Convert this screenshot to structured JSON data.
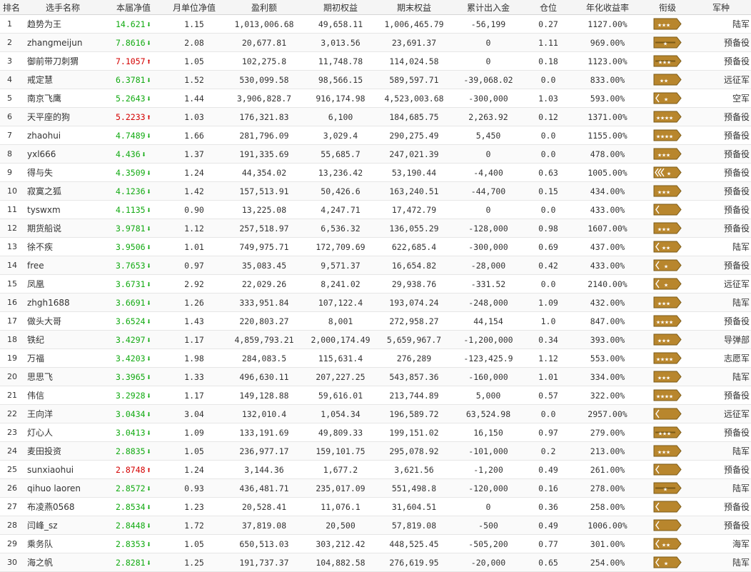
{
  "colors": {
    "up": "#d40000",
    "down": "#11aa11",
    "badge_fill": "#b8862d",
    "badge_dark": "#7a5a17",
    "badge_mark": "#ffffff"
  },
  "headers": [
    "排名",
    "选手名称",
    "本届净值",
    "月单位净值",
    "盈利额",
    "期初权益",
    "期末权益",
    "累计出入金",
    "仓位",
    "年化收益率",
    "衔级",
    "军种"
  ],
  "rows": [
    {
      "rank": "1",
      "name": "趋势为王",
      "nav": "14.621",
      "trend": "down",
      "arrow": "⬇",
      "unit_nav": "1.15",
      "profit": "1,013,006.68",
      "initial": "49,658.11",
      "final": "1,006,465.79",
      "flow": "-56,199",
      "position": "0.27",
      "annual": "1127.00%",
      "badge_icon": "stars-3",
      "branch": "陆军"
    },
    {
      "rank": "2",
      "name": "zhangmeijun",
      "nav": "7.8616",
      "trend": "down",
      "arrow": "⬇",
      "unit_nav": "2.08",
      "profit": "20,677.81",
      "initial": "3,013.56",
      "final": "23,691.37",
      "flow": "0",
      "position": "1.11",
      "annual": "969.00%",
      "badge_icon": "bar-star-1",
      "branch": "预备役"
    },
    {
      "rank": "3",
      "name": "御前带刀刺猬",
      "nav": "7.1057",
      "trend": "up",
      "arrow": "⬆",
      "unit_nav": "1.05",
      "profit": "102,275.8",
      "initial": "11,748.78",
      "final": "114,024.58",
      "flow": "0",
      "position": "0.18",
      "annual": "1123.00%",
      "badge_icon": "bar-stars-3",
      "branch": "预备役"
    },
    {
      "rank": "4",
      "name": "戒定慧",
      "nav": "6.3781",
      "trend": "down",
      "arrow": "⬇",
      "unit_nav": "1.52",
      "profit": "530,099.58",
      "initial": "98,566.15",
      "final": "589,597.71",
      "flow": "-39,068.02",
      "position": "0.0",
      "annual": "833.00%",
      "badge_icon": "stars-2",
      "branch": "远征军"
    },
    {
      "rank": "5",
      "name": "南京飞鹰",
      "nav": "5.2643",
      "trend": "down",
      "arrow": "⬇",
      "unit_nav": "1.44",
      "profit": "3,906,828.7",
      "initial": "916,174.98",
      "final": "4,523,003.68",
      "flow": "-300,000",
      "position": "1.03",
      "annual": "593.00%",
      "badge_icon": "chevron-star",
      "branch": "空军"
    },
    {
      "rank": "6",
      "name": "天平座的狗",
      "nav": "5.2233",
      "trend": "up",
      "arrow": "⬆",
      "unit_nav": "1.03",
      "profit": "176,321.83",
      "initial": "6,100",
      "final": "184,685.75",
      "flow": "2,263.92",
      "position": "0.12",
      "annual": "1371.00%",
      "badge_icon": "stars-4",
      "branch": "预备役"
    },
    {
      "rank": "7",
      "name": "zhaohui",
      "nav": "4.7489",
      "trend": "down",
      "arrow": "⬇",
      "unit_nav": "1.66",
      "profit": "281,796.09",
      "initial": "3,029.4",
      "final": "290,275.49",
      "flow": "5,450",
      "position": "0.0",
      "annual": "1155.00%",
      "badge_icon": "stars-4",
      "branch": "预备役"
    },
    {
      "rank": "8",
      "name": "yxl666",
      "nav": "4.436",
      "trend": "down",
      "arrow": "⬇",
      "unit_nav": "1.37",
      "profit": "191,335.69",
      "initial": "55,685.7",
      "final": "247,021.39",
      "flow": "0",
      "position": "0.0",
      "annual": "478.00%",
      "badge_icon": "stars-3",
      "branch": "预备役"
    },
    {
      "rank": "9",
      "name": "得与失",
      "nav": "4.3509",
      "trend": "down",
      "arrow": "⬇",
      "unit_nav": "1.24",
      "profit": "44,354.02",
      "initial": "13,236.42",
      "final": "53,190.44",
      "flow": "-4,400",
      "position": "0.63",
      "annual": "1005.00%",
      "badge_icon": "chevron3-star",
      "branch": "预备役"
    },
    {
      "rank": "10",
      "name": "寂寞之狐",
      "nav": "4.1236",
      "trend": "down",
      "arrow": "⬇",
      "unit_nav": "1.42",
      "profit": "157,513.91",
      "initial": "50,426.6",
      "final": "163,240.51",
      "flow": "-44,700",
      "position": "0.15",
      "annual": "434.00%",
      "badge_icon": "stars-3",
      "branch": "预备役"
    },
    {
      "rank": "11",
      "name": "tyswxm",
      "nav": "4.1135",
      "trend": "down",
      "arrow": "⬇",
      "unit_nav": "0.90",
      "profit": "13,225.08",
      "initial": "4,247.71",
      "final": "17,472.79",
      "flow": "0",
      "position": "0.0",
      "annual": "433.00%",
      "badge_icon": "chevron-1",
      "branch": "预备役"
    },
    {
      "rank": "12",
      "name": "期货船说",
      "nav": "3.9781",
      "trend": "down",
      "arrow": "⬇",
      "unit_nav": "1.12",
      "profit": "257,518.97",
      "initial": "6,536.32",
      "final": "136,055.29",
      "flow": "-128,000",
      "position": "0.98",
      "annual": "1607.00%",
      "badge_icon": "stars-3",
      "branch": "预备役"
    },
    {
      "rank": "13",
      "name": "徐不疾",
      "nav": "3.9506",
      "trend": "down",
      "arrow": "⬇",
      "unit_nav": "1.01",
      "profit": "749,975.71",
      "initial": "172,709.69",
      "final": "622,685.4",
      "flow": "-300,000",
      "position": "0.69",
      "annual": "437.00%",
      "badge_icon": "chevron-stars-2",
      "branch": "陆军"
    },
    {
      "rank": "14",
      "name": "free",
      "nav": "3.7653",
      "trend": "down",
      "arrow": "⬇",
      "unit_nav": "0.97",
      "profit": "35,083.45",
      "initial": "9,571.37",
      "final": "16,654.82",
      "flow": "-28,000",
      "position": "0.42",
      "annual": "433.00%",
      "badge_icon": "chevron-star",
      "branch": "预备役"
    },
    {
      "rank": "15",
      "name": "凤凰",
      "nav": "3.6731",
      "trend": "down",
      "arrow": "⬇",
      "unit_nav": "2.92",
      "profit": "22,029.26",
      "initial": "8,241.02",
      "final": "29,938.76",
      "flow": "-331.52",
      "position": "0.0",
      "annual": "2140.00%",
      "badge_icon": "chevron-star",
      "branch": "远征军"
    },
    {
      "rank": "16",
      "name": "zhgh1688",
      "nav": "3.6691",
      "trend": "down",
      "arrow": "⬇",
      "unit_nav": "1.26",
      "profit": "333,951.84",
      "initial": "107,122.4",
      "final": "193,074.24",
      "flow": "-248,000",
      "position": "1.09",
      "annual": "432.00%",
      "badge_icon": "stars-3",
      "branch": "陆军"
    },
    {
      "rank": "17",
      "name": "做头大哥",
      "nav": "3.6524",
      "trend": "down",
      "arrow": "⬇",
      "unit_nav": "1.43",
      "profit": "220,803.27",
      "initial": "8,001",
      "final": "272,958.27",
      "flow": "44,154",
      "position": "1.0",
      "annual": "847.00%",
      "badge_icon": "stars-4",
      "branch": "预备役"
    },
    {
      "rank": "18",
      "name": "铁纪",
      "nav": "3.4297",
      "trend": "down",
      "arrow": "⬇",
      "unit_nav": "1.17",
      "profit": "4,859,793.21",
      "initial": "2,000,174.49",
      "final": "5,659,967.7",
      "flow": "-1,200,000",
      "position": "0.34",
      "annual": "393.00%",
      "badge_icon": "stars-3",
      "branch": "导弹部"
    },
    {
      "rank": "19",
      "name": "万福",
      "nav": "3.4203",
      "trend": "down",
      "arrow": "⬇",
      "unit_nav": "1.98",
      "profit": "284,083.5",
      "initial": "115,631.4",
      "final": "276,289",
      "flow": "-123,425.9",
      "position": "1.12",
      "annual": "553.00%",
      "badge_icon": "stars-4",
      "branch": "志愿军"
    },
    {
      "rank": "20",
      "name": "思思飞",
      "nav": "3.3965",
      "trend": "down",
      "arrow": "⬇",
      "unit_nav": "1.33",
      "profit": "496,630.11",
      "initial": "207,227.25",
      "final": "543,857.36",
      "flow": "-160,000",
      "position": "1.01",
      "annual": "334.00%",
      "badge_icon": "stars-3",
      "branch": "陆军"
    },
    {
      "rank": "21",
      "name": "伟信",
      "nav": "3.2928",
      "trend": "down",
      "arrow": "⬇",
      "unit_nav": "1.17",
      "profit": "149,128.88",
      "initial": "59,616.01",
      "final": "213,744.89",
      "flow": "5,000",
      "position": "0.57",
      "annual": "322.00%",
      "badge_icon": "stars-4",
      "branch": "预备役"
    },
    {
      "rank": "22",
      "name": "王向洋",
      "nav": "3.0434",
      "trend": "down",
      "arrow": "⬇",
      "unit_nav": "3.04",
      "profit": "132,010.4",
      "initial": "1,054.34",
      "final": "196,589.72",
      "flow": "63,524.98",
      "position": "0.0",
      "annual": "2957.00%",
      "badge_icon": "chevron-1",
      "branch": "远征军"
    },
    {
      "rank": "23",
      "name": "灯心人",
      "nav": "3.0413",
      "trend": "down",
      "arrow": "⬇",
      "unit_nav": "1.09",
      "profit": "133,191.69",
      "initial": "49,809.33",
      "final": "199,151.02",
      "flow": "16,150",
      "position": "0.97",
      "annual": "279.00%",
      "badge_icon": "bar-stars-3",
      "branch": "预备役"
    },
    {
      "rank": "24",
      "name": "麦田投资",
      "nav": "2.8835",
      "trend": "down",
      "arrow": "⬇",
      "unit_nav": "1.05",
      "profit": "236,977.17",
      "initial": "159,101.75",
      "final": "295,078.92",
      "flow": "-101,000",
      "position": "0.2",
      "annual": "213.00%",
      "badge_icon": "stars-3",
      "branch": "陆军"
    },
    {
      "rank": "25",
      "name": "sunxiaohui",
      "nav": "2.8748",
      "trend": "up",
      "arrow": "⬆",
      "unit_nav": "1.24",
      "profit": "3,144.36",
      "initial": "1,677.2",
      "final": "3,621.56",
      "flow": "-1,200",
      "position": "0.49",
      "annual": "261.00%",
      "badge_icon": "chevron-1",
      "branch": "预备役"
    },
    {
      "rank": "26",
      "name": "qihuo laoren",
      "nav": "2.8572",
      "trend": "down",
      "arrow": "⬇",
      "unit_nav": "0.93",
      "profit": "436,481.71",
      "initial": "235,017.09",
      "final": "551,498.8",
      "flow": "-120,000",
      "position": "0.16",
      "annual": "278.00%",
      "badge_icon": "bar-star-1",
      "branch": "陆军"
    },
    {
      "rank": "27",
      "name": "布凌燕0568",
      "nav": "2.8534",
      "trend": "down",
      "arrow": "⬇",
      "unit_nav": "1.23",
      "profit": "20,528.41",
      "initial": "11,076.1",
      "final": "31,604.51",
      "flow": "0",
      "position": "0.36",
      "annual": "258.00%",
      "badge_icon": "chevron-1",
      "branch": "预备役"
    },
    {
      "rank": "28",
      "name": "闫峰_sz",
      "nav": "2.8448",
      "trend": "down",
      "arrow": "⬇",
      "unit_nav": "1.72",
      "profit": "37,819.08",
      "initial": "20,500",
      "final": "57,819.08",
      "flow": "-500",
      "position": "0.49",
      "annual": "1006.00%",
      "badge_icon": "chevron-1",
      "branch": "预备役"
    },
    {
      "rank": "29",
      "name": "乘务队",
      "nav": "2.8353",
      "trend": "down",
      "arrow": "⬇",
      "unit_nav": "1.05",
      "profit": "650,513.03",
      "initial": "303,212.42",
      "final": "448,525.45",
      "flow": "-505,200",
      "position": "0.77",
      "annual": "301.00%",
      "badge_icon": "chevron-stars-2",
      "branch": "海军"
    },
    {
      "rank": "30",
      "name": "海之帆",
      "nav": "2.8281",
      "trend": "down",
      "arrow": "⬇",
      "unit_nav": "1.25",
      "profit": "191,737.37",
      "initial": "104,882.58",
      "final": "276,619.95",
      "flow": "-20,000",
      "position": "0.65",
      "annual": "254.00%",
      "badge_icon": "chevron-star",
      "branch": "陆军"
    }
  ]
}
